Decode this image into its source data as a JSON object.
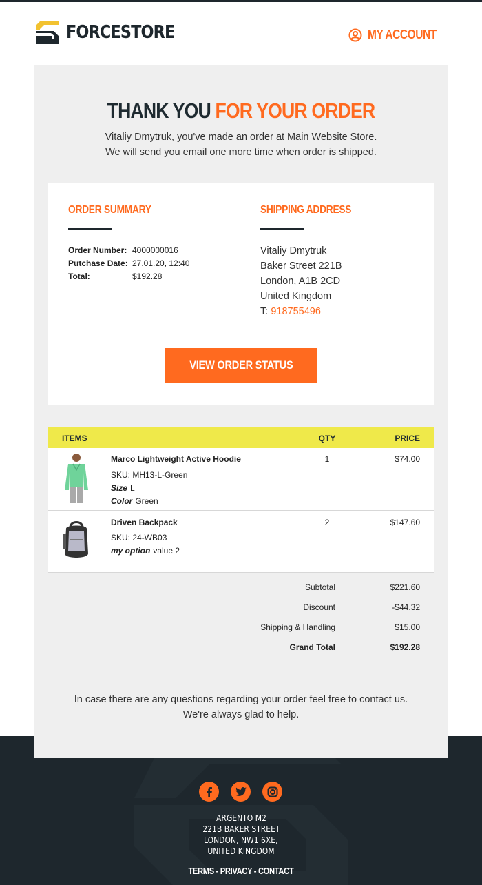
{
  "brand": {
    "name": "FORCESTORE",
    "logo_colors": [
      "#f2c230",
      "#1e272d"
    ]
  },
  "header": {
    "account_label": "MY ACCOUNT"
  },
  "hero": {
    "title_part1": "THANK YOU",
    "title_part2": "FOR YOUR ORDER",
    "line1": "Vitaliy Dmytruk, you've made an order at Main Website Store.",
    "line2": "We will send you email one more time when order is shipped."
  },
  "summary": {
    "title": "ORDER SUMMARY",
    "rows": [
      {
        "label": "Order Number:",
        "value": "4000000016"
      },
      {
        "label": "Putchase Date:",
        "value": "27.01.20, 12:40"
      },
      {
        "label": "Total:",
        "value": "$192.28"
      }
    ]
  },
  "shipping": {
    "title": "SHIPPING ADDRESS",
    "lines": [
      "Vitaliy Dmytruk",
      "Baker Street 221B",
      "London, A1B 2CD",
      "United Kingdom"
    ],
    "phone_prefix": "T:",
    "phone": "918755496"
  },
  "cta": {
    "label": "VIEW ORDER STATUS"
  },
  "items_table": {
    "headers": {
      "items": "ITEMS",
      "qty": "QTY",
      "price": "PRICE"
    },
    "rows": [
      {
        "name": "Marco Lightweight Active Hoodie",
        "sku": "SKU: MH13-L-Green",
        "options": [
          {
            "label": "Size",
            "value": "L"
          },
          {
            "label": "Color",
            "value": "Green"
          }
        ],
        "qty": "1",
        "price": "$74.00"
      },
      {
        "name": "Driven Backpack",
        "sku": "SKU: 24-WB03",
        "options": [
          {
            "label": "my option",
            "value": "value 2"
          }
        ],
        "qty": "2",
        "price": "$147.60"
      }
    ]
  },
  "totals": [
    {
      "label": "Subtotal",
      "value": "$221.60"
    },
    {
      "label": "Discount",
      "value": "-$44.32"
    },
    {
      "label": "Shipping & Handling",
      "value": "$15.00"
    },
    {
      "label": "Grand Total",
      "value": "$192.28"
    }
  ],
  "closing": "In case there are any questions regarding your order feel free to contact us. We're always glad to help.",
  "footer": {
    "social": [
      "facebook-icon",
      "twitter-icon",
      "instagram-icon"
    ],
    "address_lines": [
      "ARGENTO M2",
      "221B BAKER STREET",
      "LONDON, NW1 6XE,",
      "UNITED KINGDOM"
    ],
    "links": [
      "TERMS",
      "PRIVACY",
      "CONTACT"
    ],
    "link_separator": " - "
  },
  "colors": {
    "accent": "#ff6a1f",
    "dark": "#1e272d",
    "table_header": "#efe94a",
    "panel": "#efefef"
  }
}
